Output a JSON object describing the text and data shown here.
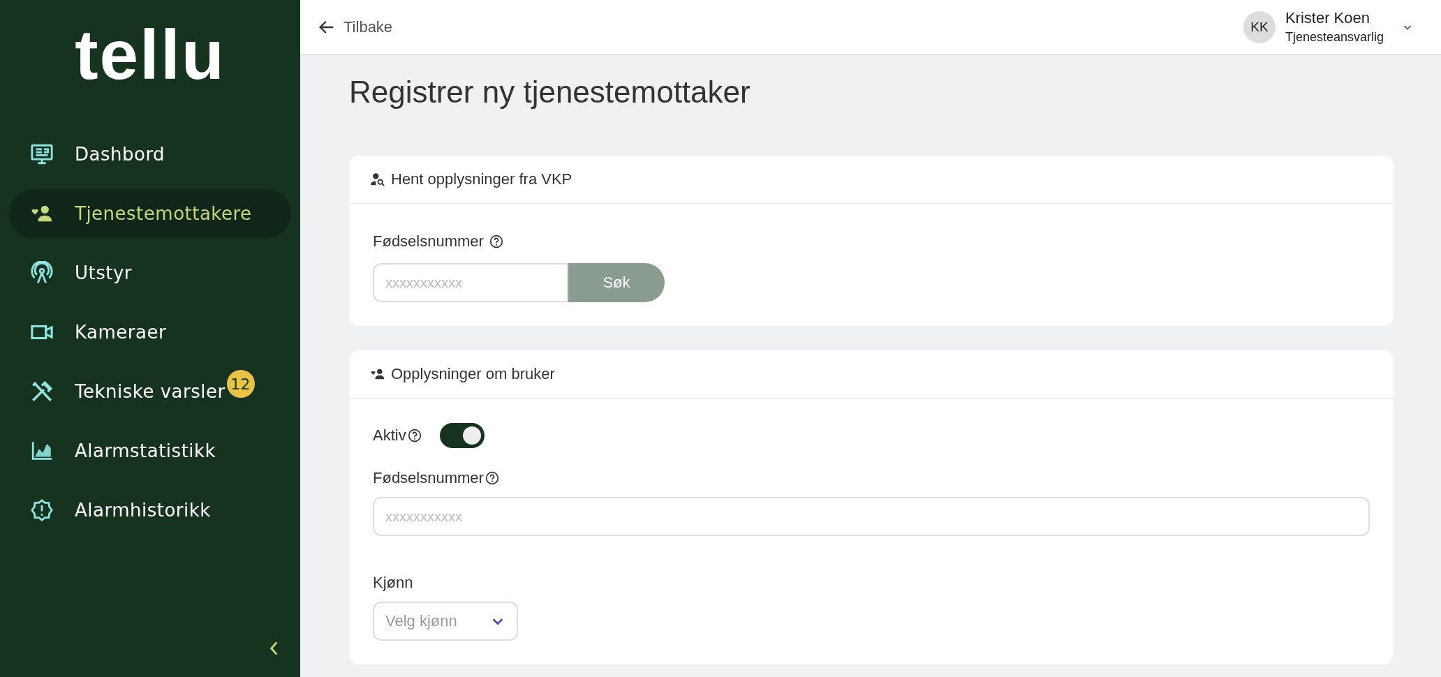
{
  "sidebar": {
    "logo": "tellu",
    "items": [
      {
        "label": "Dashbord",
        "kind": "monitor",
        "selected": false
      },
      {
        "label": "Tjenestemottakere",
        "kind": "people",
        "selected": true
      },
      {
        "label": "Utstyr",
        "kind": "antenna",
        "selected": false
      },
      {
        "label": "Kameraer",
        "kind": "camera",
        "selected": false
      },
      {
        "label": "Tekniske varsler",
        "kind": "tools",
        "selected": false,
        "badge": "12"
      },
      {
        "label": "Alarmstatistikk",
        "kind": "chart",
        "selected": false
      },
      {
        "label": "Alarmhistorikk",
        "kind": "alert",
        "selected": false
      }
    ]
  },
  "topbar": {
    "back": "Tilbake",
    "user": {
      "initials": "KK",
      "name": "Krister Koen",
      "role": "Tjenesteansvarlig"
    }
  },
  "title": "Registrer ny tjenestemottaker",
  "lookup": {
    "title": "Hent opplysninger fra VKP",
    "label": "Fødselsnummer",
    "placeholder": "xxxxxxxxxxx",
    "button": "Søk"
  },
  "user_info": {
    "title": "Opplysninger om bruker",
    "active_label": "Aktiv",
    "active": true,
    "ssn_label": "Fødselsnummer",
    "ssn_placeholder": "xxxxxxxxxxx",
    "gender_label": "Kjønn",
    "gender_placeholder": "Velg kjønn"
  }
}
